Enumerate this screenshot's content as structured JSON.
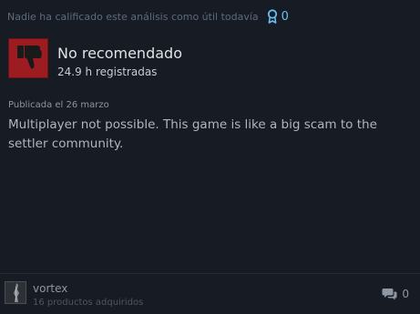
{
  "review": {
    "helpful_text": "Nadie ha calificado este análisis como útil todavía",
    "award_count": "0",
    "rating": "No recomendado",
    "hours": "24.9 h registradas",
    "posted": "Publicada el 26 marzo",
    "body": "Multiplayer not possible. This game is like a big scam to the settler community."
  },
  "author": {
    "name": "vortex",
    "products": "16 productos adquiridos"
  },
  "comments": {
    "count": "0"
  },
  "icons": {
    "award": "award-ribbon-icon",
    "rating": "thumbs-down-icon",
    "comments": "comment-bubbles-icon"
  },
  "colors": {
    "background": "#161b24",
    "thumb_red": "#9d1c21",
    "accent_blue": "#66c0f4"
  }
}
